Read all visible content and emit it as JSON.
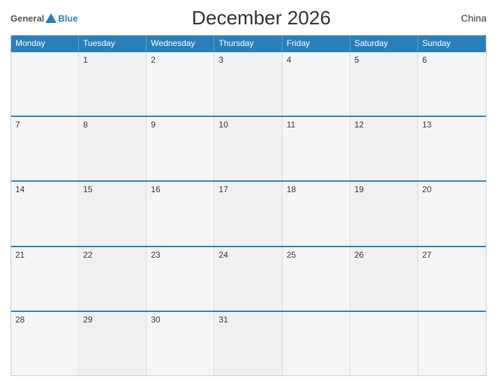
{
  "header": {
    "title": "December 2026",
    "country": "China",
    "logo": {
      "general": "General",
      "blue": "Blue"
    }
  },
  "days_of_week": [
    "Monday",
    "Tuesday",
    "Wednesday",
    "Thursday",
    "Friday",
    "Saturday",
    "Sunday"
  ],
  "weeks": [
    [
      {
        "day": "",
        "empty": true
      },
      {
        "day": "1"
      },
      {
        "day": "2"
      },
      {
        "day": "3"
      },
      {
        "day": "4"
      },
      {
        "day": "5"
      },
      {
        "day": "6"
      }
    ],
    [
      {
        "day": "7"
      },
      {
        "day": "8"
      },
      {
        "day": "9"
      },
      {
        "day": "10"
      },
      {
        "day": "11"
      },
      {
        "day": "12"
      },
      {
        "day": "13"
      }
    ],
    [
      {
        "day": "14"
      },
      {
        "day": "15"
      },
      {
        "day": "16"
      },
      {
        "day": "17"
      },
      {
        "day": "18"
      },
      {
        "day": "19"
      },
      {
        "day": "20"
      }
    ],
    [
      {
        "day": "21"
      },
      {
        "day": "22"
      },
      {
        "day": "23"
      },
      {
        "day": "24"
      },
      {
        "day": "25"
      },
      {
        "day": "26"
      },
      {
        "day": "27"
      }
    ],
    [
      {
        "day": "28"
      },
      {
        "day": "29"
      },
      {
        "day": "30"
      },
      {
        "day": "31"
      },
      {
        "day": "",
        "empty": true
      },
      {
        "day": "",
        "empty": true
      },
      {
        "day": "",
        "empty": true
      }
    ]
  ],
  "accent_color": "#2980b9"
}
